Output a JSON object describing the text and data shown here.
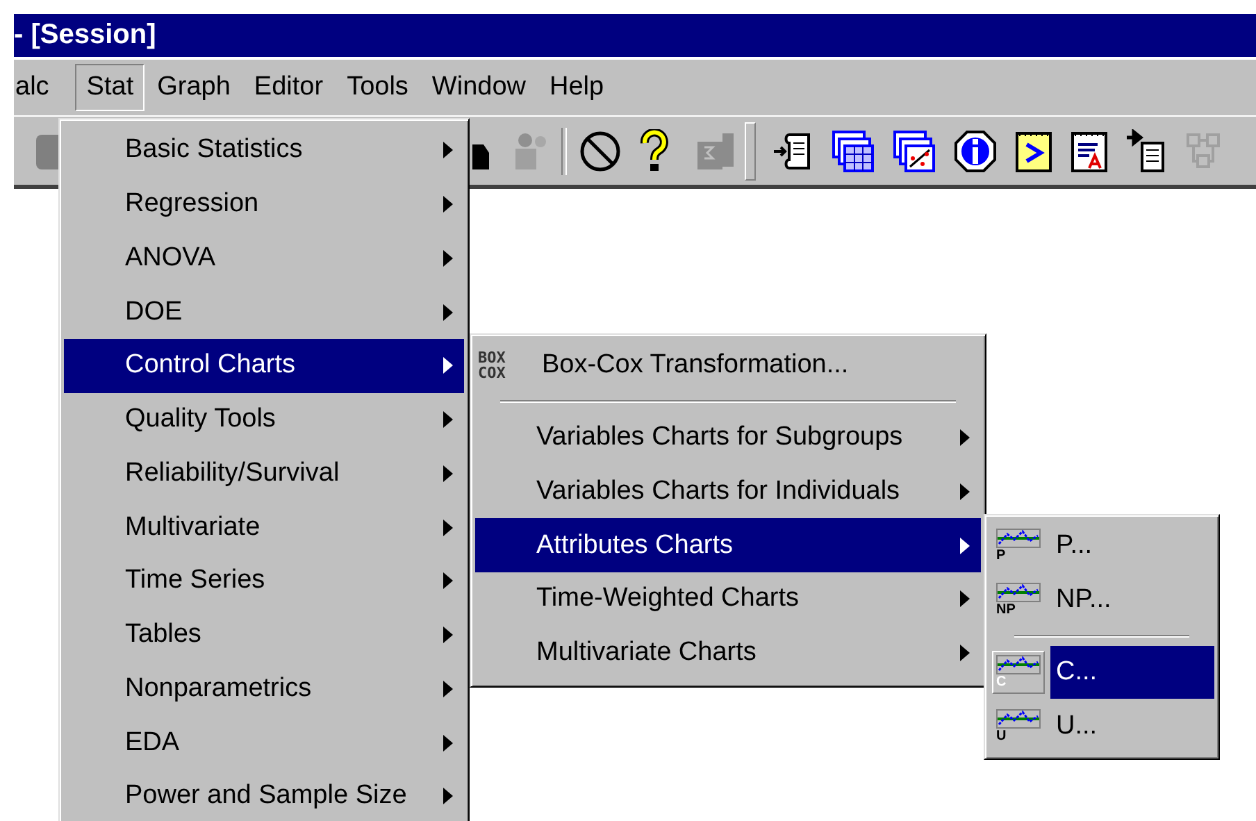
{
  "window": {
    "title": "- [Session]"
  },
  "menubar": [
    {
      "label": "alc",
      "selected": false
    },
    {
      "label": "Stat",
      "selected": true
    },
    {
      "label": "Graph",
      "selected": false
    },
    {
      "label": "Editor",
      "selected": false
    },
    {
      "label": "Tools",
      "selected": false
    },
    {
      "label": "Window",
      "selected": false
    },
    {
      "label": "Help",
      "selected": false
    }
  ],
  "stat_menu": {
    "items": [
      {
        "kind": "item",
        "label": "Basic Statistics",
        "submenu": true,
        "selected": false
      },
      {
        "kind": "item",
        "label": "Regression",
        "submenu": true,
        "selected": false
      },
      {
        "kind": "item",
        "label": "ANOVA",
        "submenu": true,
        "selected": false
      },
      {
        "kind": "item",
        "label": "DOE",
        "submenu": true,
        "selected": false
      },
      {
        "kind": "item",
        "label": "Control Charts",
        "submenu": true,
        "selected": true
      },
      {
        "kind": "item",
        "label": "Quality Tools",
        "submenu": true,
        "selected": false
      },
      {
        "kind": "item",
        "label": "Reliability/Survival",
        "submenu": true,
        "selected": false
      },
      {
        "kind": "item",
        "label": "Multivariate",
        "submenu": true,
        "selected": false
      },
      {
        "kind": "item",
        "label": "Time Series",
        "submenu": true,
        "selected": false
      },
      {
        "kind": "item",
        "label": "Tables",
        "submenu": true,
        "selected": false
      },
      {
        "kind": "item",
        "label": "Nonparametrics",
        "submenu": true,
        "selected": false
      },
      {
        "kind": "item",
        "label": "EDA",
        "submenu": true,
        "selected": false
      },
      {
        "kind": "item",
        "label": "Power and Sample Size",
        "submenu": true,
        "selected": false
      }
    ]
  },
  "control_charts_menu": {
    "items": [
      {
        "kind": "boxcox",
        "icon_label": "BOX COX",
        "label": "Box-Cox Transformation...",
        "submenu": false,
        "selected": false
      },
      {
        "kind": "separator"
      },
      {
        "kind": "item",
        "label": "Variables Charts for Subgroups",
        "submenu": true,
        "selected": false
      },
      {
        "kind": "item",
        "label": "Variables Charts for Individuals",
        "submenu": true,
        "selected": false
      },
      {
        "kind": "item",
        "label": "Attributes Charts",
        "submenu": true,
        "selected": true
      },
      {
        "kind": "item",
        "label": "Time-Weighted Charts",
        "submenu": true,
        "selected": false
      },
      {
        "kind": "item",
        "label": "Multivariate Charts",
        "submenu": true,
        "selected": false
      }
    ]
  },
  "attributes_charts_menu": {
    "items": [
      {
        "kind": "chart",
        "icon_label": "P",
        "label": "P...",
        "submenu": false,
        "selected": false
      },
      {
        "kind": "chart",
        "icon_label": "NP",
        "label": "NP...",
        "submenu": false,
        "selected": false
      },
      {
        "kind": "separator"
      },
      {
        "kind": "chart",
        "icon_label": "C",
        "label": "C...",
        "submenu": false,
        "selected": true
      },
      {
        "kind": "chart",
        "icon_label": "U",
        "label": "U...",
        "submenu": false,
        "selected": false
      }
    ]
  }
}
